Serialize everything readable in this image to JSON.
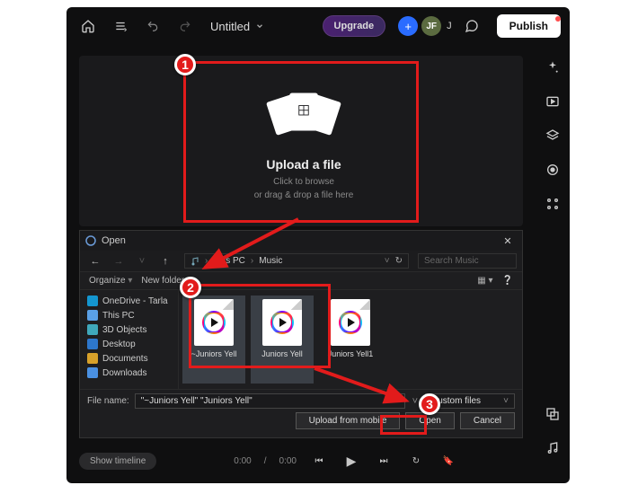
{
  "docTitle": "Untitled",
  "topbar": {
    "upgrade": "Upgrade",
    "avatar": "JF",
    "publish": "Publish"
  },
  "upload": {
    "title": "Upload a file",
    "sub1": "Click to browse",
    "sub2": "or drag & drop a file here"
  },
  "dialog": {
    "title": "Open",
    "path1": "This PC",
    "path2": "Music",
    "searchPlaceholder": "Search Music",
    "organize": "Organize",
    "newFolder": "New folder",
    "side": [
      {
        "label": "OneDrive - Tarla",
        "color": "#1496d0"
      },
      {
        "label": "This PC",
        "color": "#5aa0e6"
      },
      {
        "label": "3D Objects",
        "color": "#3fa8bb"
      },
      {
        "label": "Desktop",
        "color": "#2d77cc"
      },
      {
        "label": "Documents",
        "color": "#d8a12a"
      },
      {
        "label": "Downloads",
        "color": "#4a90e2"
      }
    ],
    "files": [
      {
        "name": "~Juniors Yell",
        "selected": true
      },
      {
        "name": "Juniors Yell",
        "selected": true
      },
      {
        "name": "Juniors Yell1",
        "selected": false
      }
    ],
    "fileNameLabel": "File name:",
    "fileNameValue": "\"~Juniors Yell\" \"Juniors Yell\"",
    "filter": "Custom files",
    "uploadMobile": "Upload from mobile",
    "open": "Open",
    "cancel": "Cancel"
  },
  "player": {
    "showTimeline": "Show timeline",
    "cur": "0:00",
    "dur": "0:00"
  },
  "annotations": {
    "n1": "1",
    "n2": "2",
    "n3": "3"
  }
}
